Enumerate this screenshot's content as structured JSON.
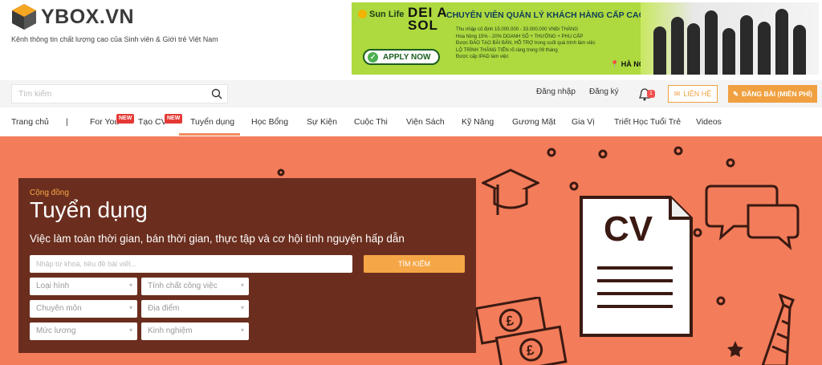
{
  "brand": {
    "name": "YBOX.VN",
    "tagline": "Kênh thông tin chất lượng cao của Sinh viên & Giới trẻ Việt Nam"
  },
  "ad": {
    "sponsor": "Sun Life",
    "brand_line1": "DEI A",
    "brand_line2": "SOL",
    "title": "CHUYÊN VIÊN QUẢN LÝ KHÁCH HÀNG CẤP CAO",
    "lines": [
      "Thu nhập cố định 15.000.000 - 33.000.000 VNĐ/ THÁNG",
      "Hoa hồng  15% - 20% DOANH SỐ + THƯỞNG + PHỤ CẤP",
      "Được ĐÀO TẠO BÀI BẢN, HỖ TRỢ trong suốt quá trình làm việc",
      "LỘ TRÌNH THĂNG TIẾN rõ ràng trong 09 tháng",
      "Được cấp IPAD làm việc"
    ],
    "apply": "APPLY NOW",
    "location": "HÀ NỘI"
  },
  "header": {
    "search_placeholder": "Tìm kiếm",
    "login": "Đăng nhập",
    "register": "Đăng ký",
    "notif_count": "1",
    "contact": "LIÊN HỆ",
    "post": "ĐĂNG BÀI (MIỄN PHÍ)"
  },
  "nav": {
    "items": [
      "Trang chủ",
      "|",
      "For You",
      "Tạo CV",
      "Tuyển dụng",
      "Học Bổng",
      "Sự Kiện",
      "Cuộc Thi",
      "Viện Sách",
      "Kỹ Năng",
      "Gương Mặt",
      "Gia Vị",
      "Triết Học Tuổi Trẻ",
      "Videos"
    ],
    "new_badge": "NEW"
  },
  "hero": {
    "category": "Cộng đồng",
    "title": "Tuyển dụng",
    "subtitle": "Việc làm toàn thời gian, bán thời gian, thực tập và cơ hội tình nguyện hấp dẫn",
    "keyword_placeholder": "Nhập từ khoá, tiêu đề bài viết...",
    "search_button": "TÌM KIẾM",
    "filters": [
      "Loại hình",
      "Tính chất công việc",
      "Chuyên môn",
      "Địa điểm",
      "Mức lương",
      "Kinh nghiệm"
    ],
    "cv_text": "CV",
    "money_symbol": "£"
  },
  "colors": {
    "accent": "#f0a040",
    "hero_bg": "#f37c5a",
    "panel_bg": "#6b2e1e"
  }
}
